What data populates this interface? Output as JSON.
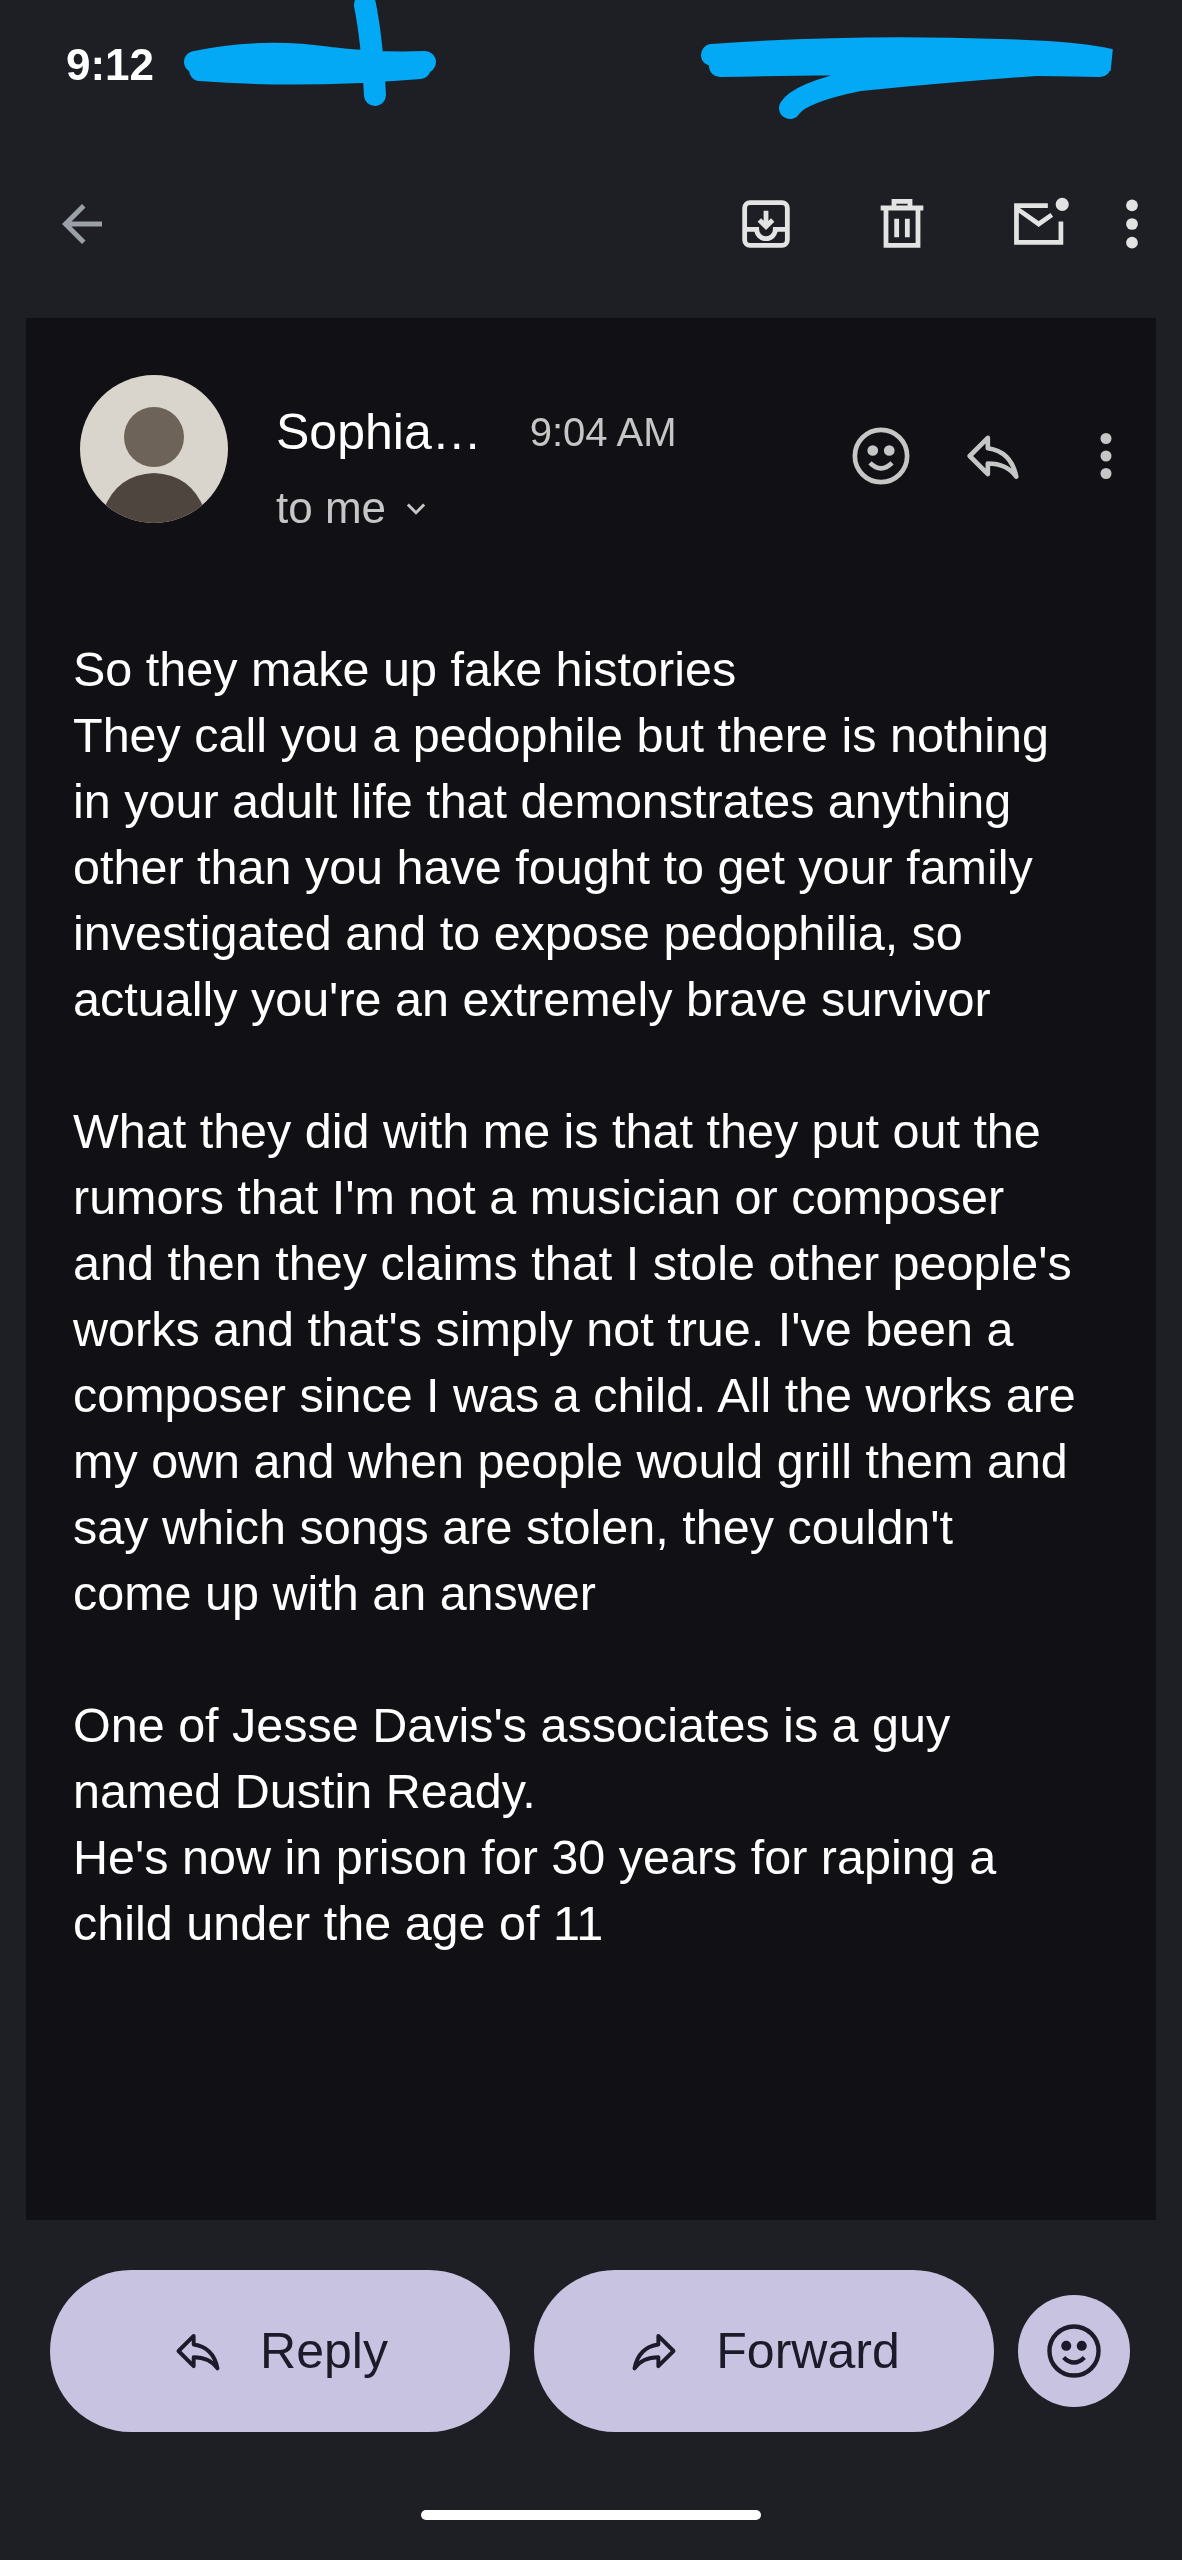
{
  "status_bar": {
    "time": "9:12"
  },
  "email": {
    "sender": "Sophia…",
    "time": "9:04 AM",
    "recipient": "to me",
    "paragraphs": [
      "So they make up fake histories\nThey call you a pedophile but there is nothing in your adult life that demonstrates anything other than you have fought to get your family investigated and to expose pedophilia, so actually you're an extremely brave survivor",
      "What they did with me is that they put out the rumors that I'm not a musician or composer and then they claims that I stole other people's works and that's simply not true. I've been a composer since I was a child. All the works are my own and when people would grill them and say which songs are stolen, they couldn't come up with an answer",
      "One of Jesse Davis's associates is a guy named Dustin Ready.\nHe's now in prison for 30 years for raping a child under the age of 11"
    ]
  },
  "actions": [
    {
      "label": "Reply",
      "kind": "reply"
    },
    {
      "label": "Forward",
      "kind": "forward"
    }
  ]
}
